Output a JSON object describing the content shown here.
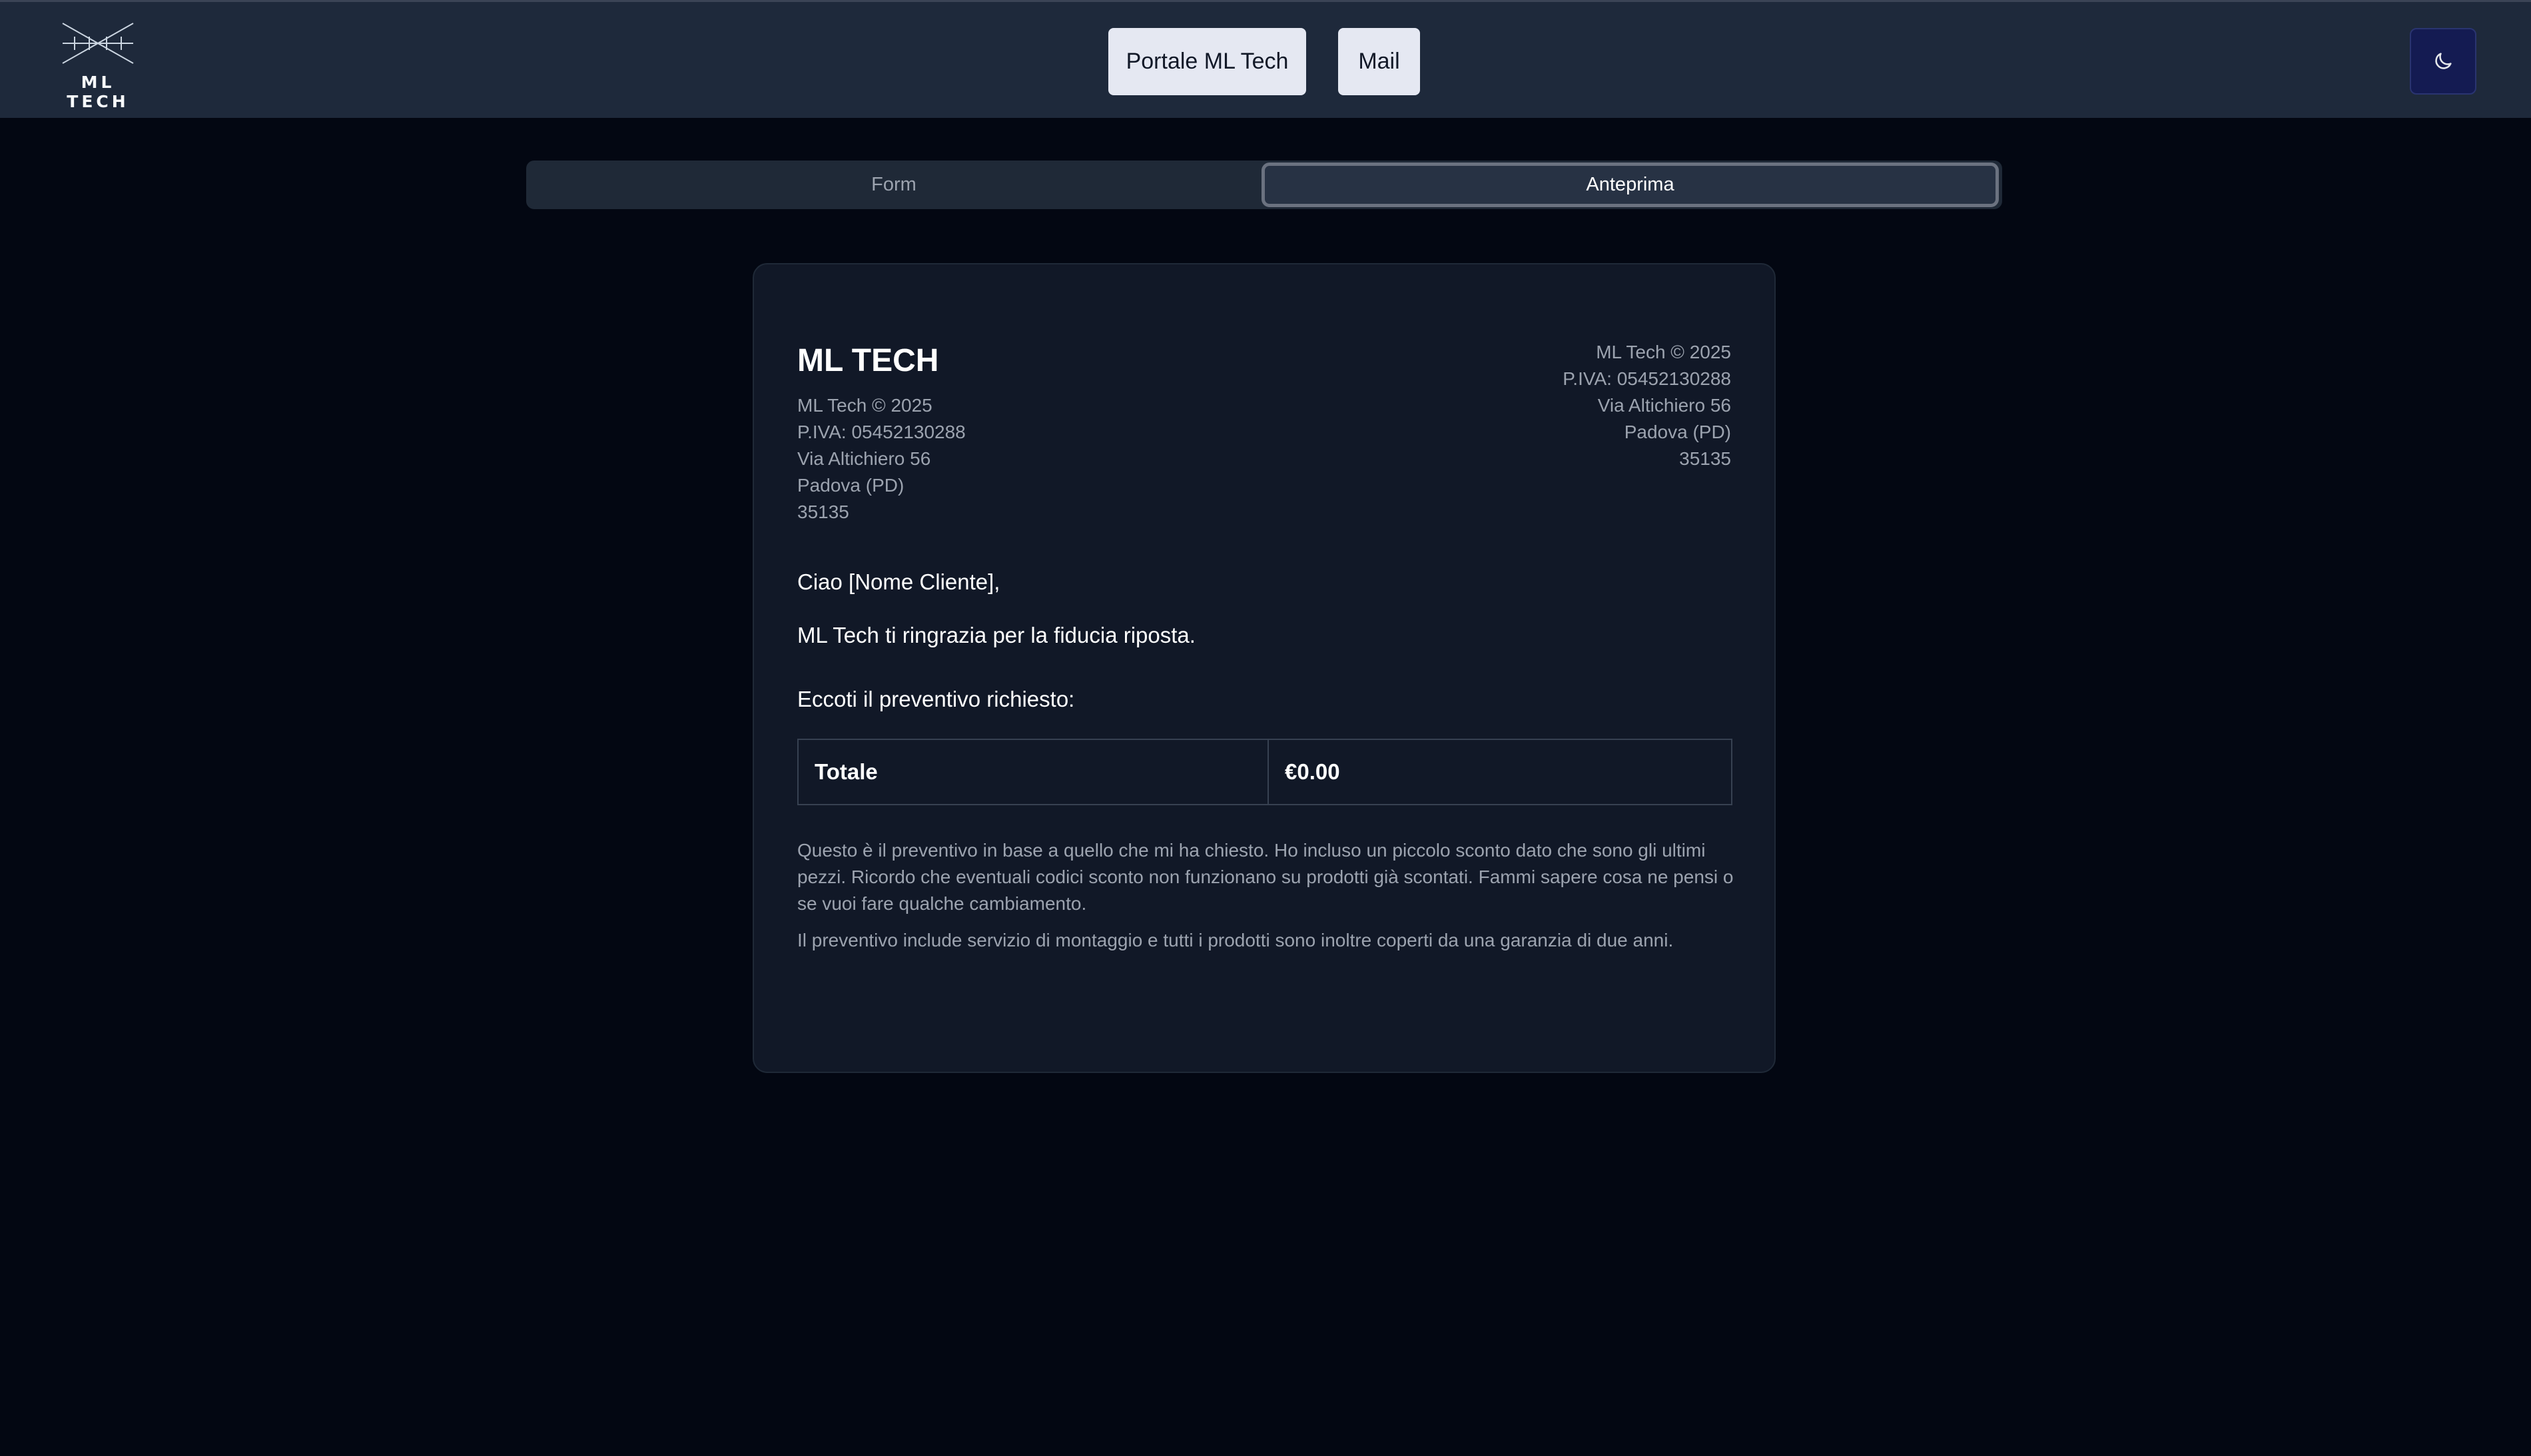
{
  "header": {
    "logo_text": "ML TECH",
    "buttons": {
      "portal": "Portale ML Tech",
      "mail": "Mail"
    },
    "theme_toggle_icon": "moon-icon"
  },
  "tabs": {
    "form": "Form",
    "preview": "Anteprima",
    "active": "Anteprima"
  },
  "document": {
    "title": "ML TECH",
    "sender": {
      "copyright": "ML Tech © 2025",
      "vat": "P.IVA: 05452130288",
      "street": "Via Altichiero 56",
      "city": "Padova (PD)",
      "zip": "35135"
    },
    "recipient": {
      "copyright": "ML Tech © 2025",
      "vat": "P.IVA: 05452130288",
      "street": "Via Altichiero 56",
      "city": "Padova (PD)",
      "zip": "35135"
    },
    "greeting": "Ciao [Nome Cliente],",
    "thanks": "ML Tech ti ringrazia per la fiducia riposta.",
    "intro": "Eccoti il preventivo richiesto:",
    "total_label": "Totale",
    "total_value": "€0.00",
    "note_1": "Questo è il preventivo in base a quello che mi ha chiesto. Ho incluso un piccolo sconto dato che sono gli ultimi pezzi. Ricordo che eventuali codici sconto non funzionano su prodotti già scontati. Fammi sapere cosa ne pensi o se vuoi fare qualche cambiamento.",
    "note_2": "Il preventivo include servizio di montaggio e tutti i prodotti sono inoltre coperti da una garanzia di due anni."
  },
  "colors": {
    "page_bg": "#030712",
    "header_bg": "#1e293b",
    "card_bg": "#111827",
    "toggle_bg": "#141b52"
  }
}
